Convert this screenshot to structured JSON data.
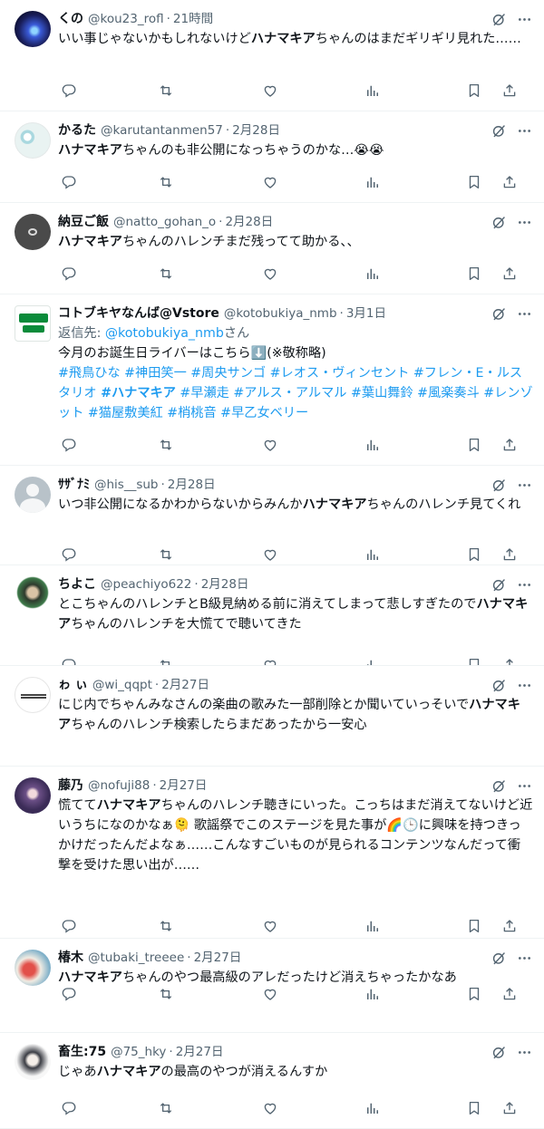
{
  "tweets": [
    {
      "name": "くの",
      "handle": "@kou23_rofl",
      "time": "21時間",
      "parts": [
        {
          "t": "いい事じゃないかもしれないけど"
        },
        {
          "t": "ハナマキア",
          "b": true
        },
        {
          "t": "ちゃんのはまだギリギリ見れた……"
        }
      ]
    },
    {
      "name": "かるた",
      "handle": "@karutantanmen57",
      "time": "2月28日",
      "parts": [
        {
          "t": "ハナマキア",
          "b": true
        },
        {
          "t": "ちゃんのも非公開になっちゃうのかな…😭😭"
        }
      ]
    },
    {
      "name": "納豆ご飯",
      "handle": "@natto_gohan_o",
      "time": "2月28日",
      "parts": [
        {
          "t": "ハナマキア",
          "b": true
        },
        {
          "t": "ちゃんのハレンチまだ残ってて助かる、、"
        }
      ]
    },
    {
      "name": "コトブキヤなんば@Vstore",
      "handle": "@kotobukiya_nmb",
      "time": "3月1日",
      "reply_label": "返信先: ",
      "reply_mention": "@kotobukiya_nmb",
      "reply_suffix": "さん",
      "parts": [
        {
          "t": "今月のお誕生日ライバーはこちら⬇️(※敬称略)\n"
        },
        {
          "t": "#飛鳥ひな #神田笑一 #周央サンゴ #レオス・ヴィンセント #フレン・E・ルスタリオ ",
          "tag": true
        },
        {
          "t": "#ハナマキア",
          "tag": true,
          "b": true
        },
        {
          "t": " #早瀬走 #アルス・アルマル #葉山舞鈴 #風楽奏斗 #レンゾット #猫屋敷美紅 #梢桃音 #早乙女ベリー",
          "tag": true
        }
      ]
    },
    {
      "name": "ｻｻﾞﾅﾐ",
      "handle": "@his__sub",
      "time": "2月28日",
      "parts": [
        {
          "t": "いつ非公開になるかわからないからみんか"
        },
        {
          "t": "ハナマキア",
          "b": true
        },
        {
          "t": "ちゃんのハレンチ見てくれ"
        }
      ]
    },
    {
      "name": "ちよこ",
      "handle": "@peachiyo622",
      "time": "2月28日",
      "parts": [
        {
          "t": "とこちゃんのハレンチとB級見納める前に消えてしまって悲しすぎたので"
        },
        {
          "t": "ハナマキア",
          "b": true
        },
        {
          "t": "ちゃんのハレンチを大慌てで聴いてきた"
        }
      ]
    },
    {
      "name": "ゎ ぃ",
      "handle": "@wi_qqpt",
      "time": "2月27日",
      "parts": [
        {
          "t": "にじ内でちゃんみなさんの楽曲の歌みた一部削除とか聞いていっそいで"
        },
        {
          "t": "ハナマキア",
          "b": true
        },
        {
          "t": "ちゃんのハレンチ検索したらまだあったから一安心"
        }
      ]
    },
    {
      "name": "藤乃",
      "handle": "@nofuji88",
      "time": "2月27日",
      "parts": [
        {
          "t": "慌てて"
        },
        {
          "t": "ハナマキア",
          "b": true
        },
        {
          "t": "ちゃんのハレンチ聴きにいった。こっちはまだ消えてないけど近いうちになのかなぁ🫠 歌謡祭でこのステージを見た事が🌈🕒に興味を持つきっかけだったんだよなぁ……こんなすごいものが見られるコンテンツなんだって衝撃を受けた思い出が……"
        }
      ]
    },
    {
      "name": "椿木",
      "handle": "@tubaki_treeee",
      "time": "2月27日",
      "parts": [
        {
          "t": "ハナマキア",
          "b": true
        },
        {
          "t": "ちゃんのやつ最高級のアレだったけど消えちゃったかなあ"
        }
      ]
    },
    {
      "name": "畜生:75",
      "handle": "@75_hky",
      "time": "2月27日",
      "parts": [
        {
          "t": "じゃあ"
        },
        {
          "t": "ハナマキア",
          "b": true
        },
        {
          "t": "の最高のやつが消えるんすか"
        }
      ]
    }
  ],
  "separator": "·",
  "icons": {
    "grok": "grok-icon",
    "more": "more-icon",
    "reply": "reply-icon",
    "retweet": "retweet-icon",
    "like": "like-icon",
    "views": "views-icon",
    "bookmark": "bookmark-icon",
    "share": "share-icon"
  },
  "colors": {
    "text": "#0f1419",
    "secondary": "#536471",
    "link": "#1d9bf0",
    "border": "#eff3f4"
  }
}
